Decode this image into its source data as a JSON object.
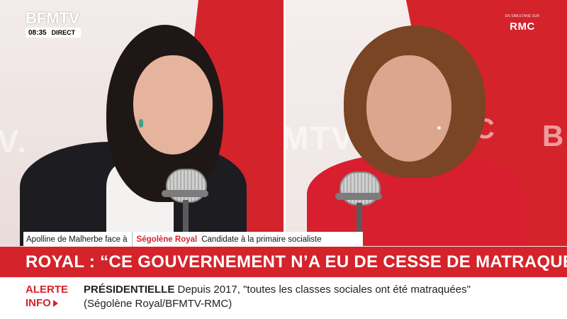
{
  "channel": {
    "logo": "BFMTV",
    "time": "08:35",
    "live": "DIRECT",
    "partner_small": "EN SIMULTANÉ SUR",
    "partner": "RMC"
  },
  "strap": {
    "host": "Apolline de Malherbe face à",
    "guest": "Ségolène Royal",
    "role": "Candidate à la primaire socialiste"
  },
  "headline": "ROYAL : “CE GOUVERNEMENT N’A EU DE CESSE DE MATRAQUER“",
  "ticker": {
    "alert_line1": "ALERTE",
    "alert_line2": "INFO",
    "keyword": "PRÉSIDENTIELLE",
    "text": "Depuis 2017, \"toutes les classes sociales ont été matraquées\" (Ségolène Royal/BFMTV-RMC)"
  },
  "colors": {
    "brand_red": "#d5232b",
    "white": "#ffffff"
  },
  "wall_left": "V.",
  "wall_right_a": "MTV",
  "wall_right_b": "C",
  "wall_right_c": "B"
}
